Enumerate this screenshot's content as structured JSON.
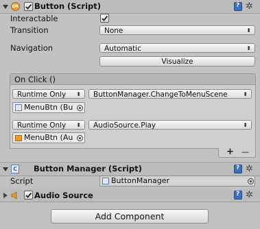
{
  "button_component": {
    "title": "Button (Script)",
    "badge": "OK",
    "interactable_label": "Interactable",
    "interactable_checked": true,
    "transition_label": "Transition",
    "transition_value": "None",
    "navigation_label": "Navigation",
    "navigation_value": "Automatic",
    "visualize_label": "Visualize",
    "onclick": {
      "title": "On Click ()",
      "entries": [
        {
          "runtime": "Runtime Only",
          "function": "ButtonManager.ChangeToMenuScene",
          "object": "MenuBtn (Bu"
        },
        {
          "runtime": "Runtime Only",
          "function": "AudioSource.Play",
          "object": "MenuBtn (Au"
        }
      ],
      "add_symbol": "+",
      "remove_symbol": "—"
    }
  },
  "button_manager": {
    "title": "Button Manager (Script)",
    "script_label": "Script",
    "script_value": "ButtonManager"
  },
  "audio_source": {
    "title": "Audio Source",
    "enabled": true
  },
  "add_component_label": "Add Component"
}
